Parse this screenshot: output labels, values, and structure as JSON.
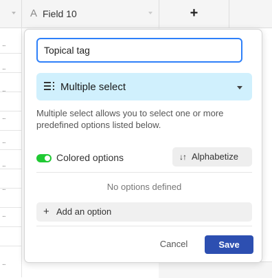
{
  "grid": {
    "field_header": {
      "type_icon": "A",
      "name": "Field 10"
    },
    "add_field_icon": "+",
    "row_marker": "··"
  },
  "popup": {
    "field_name_value": "Topical tag",
    "field_type": {
      "icon": "multiple-select-icon",
      "label": "Multiple select"
    },
    "description": "Multiple select allows you to select one or more predefined options listed below.",
    "colored_options": {
      "label": "Colored options",
      "enabled": true
    },
    "alphabetize": {
      "icon": "↓↑",
      "label": "Alphabetize"
    },
    "empty_state": "No options defined",
    "add_option": {
      "icon": "+",
      "label": "Add an option"
    },
    "cancel_label": "Cancel",
    "save_label": "Save"
  },
  "colors": {
    "accent_blue": "#2d7ff9",
    "save_blue": "#2d4fb1",
    "type_select_bg": "#d0f0fd",
    "toggle_green": "#20c933"
  }
}
